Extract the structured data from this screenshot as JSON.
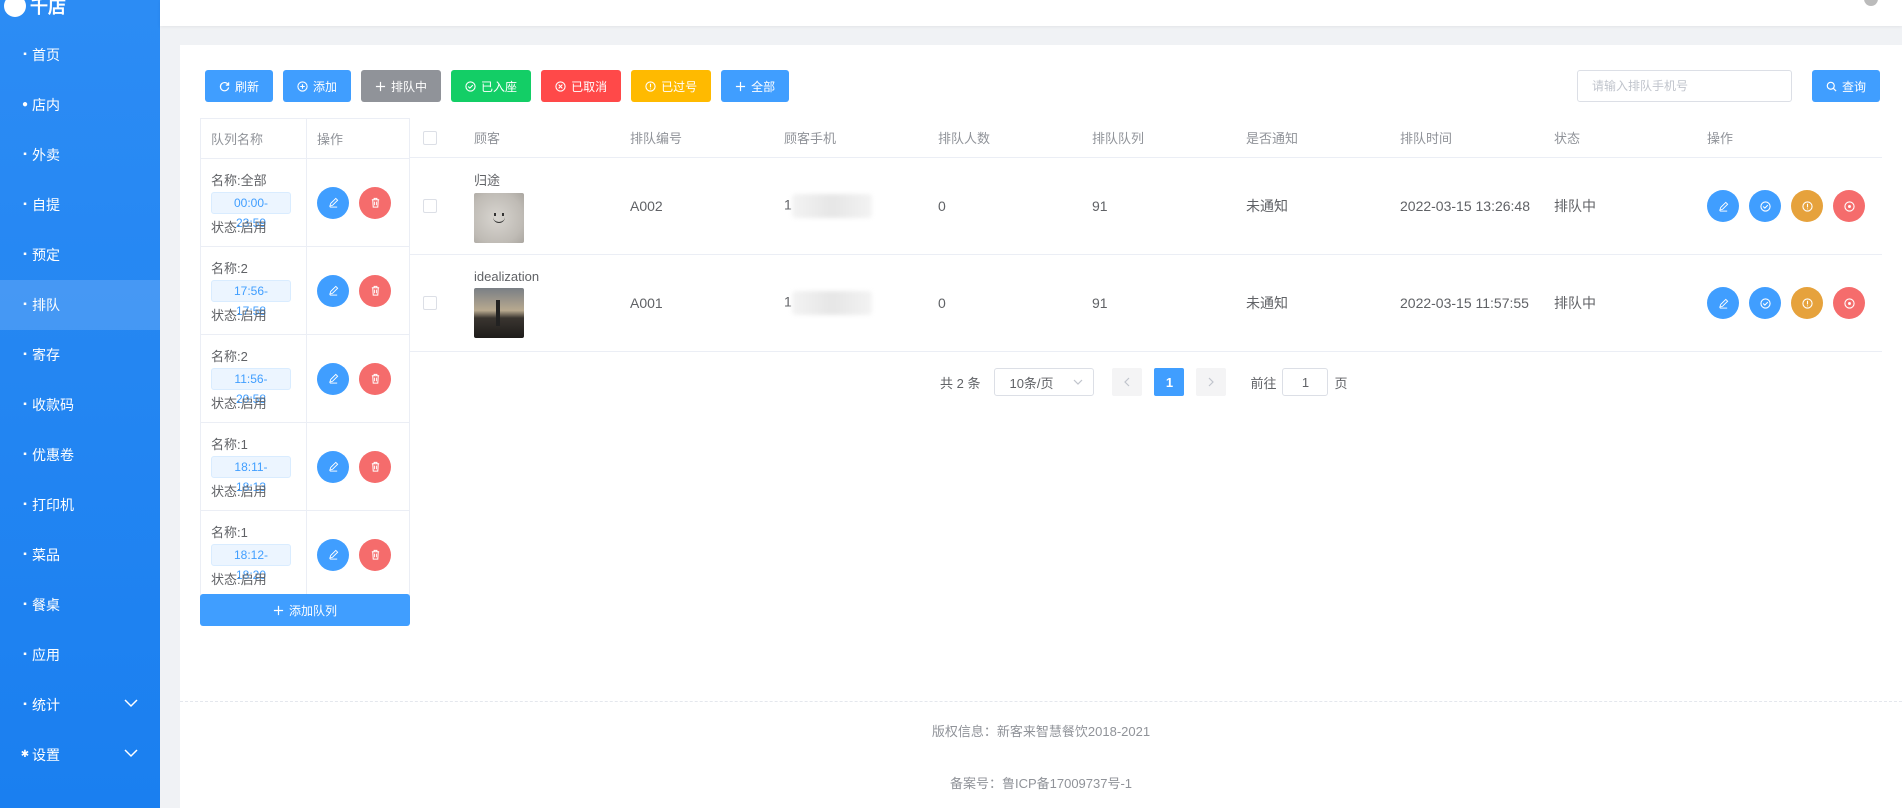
{
  "app": {
    "logo_text": "千店"
  },
  "sidebar": {
    "items": [
      {
        "label": "首页",
        "icon": "home-icon"
      },
      {
        "label": "店内",
        "icon": "user-icon"
      },
      {
        "label": "外卖",
        "icon": "delivery-icon"
      },
      {
        "label": "自提",
        "icon": "bag-icon"
      },
      {
        "label": "预定",
        "icon": "cart-icon"
      },
      {
        "label": "排队",
        "icon": "queue-icon",
        "active": true
      },
      {
        "label": "寄存",
        "icon": "box-icon"
      },
      {
        "label": "收款码",
        "icon": "qrcode-icon"
      },
      {
        "label": "优惠卷",
        "icon": "coupon-icon"
      },
      {
        "label": "打印机",
        "icon": "printer-icon"
      },
      {
        "label": "菜品",
        "icon": "dish-icon"
      },
      {
        "label": "餐桌",
        "icon": "table-icon"
      },
      {
        "label": "应用",
        "icon": "app-icon"
      },
      {
        "label": "统计",
        "icon": "stats-icon",
        "expandable": true
      },
      {
        "label": "设置",
        "icon": "gear-icon",
        "expandable": true
      }
    ]
  },
  "toolbar": {
    "refresh": "刷新",
    "add": "添加",
    "queuing": "排队中",
    "seated": "已入座",
    "cancelled": "已取消",
    "passed": "已过号",
    "all": "全部"
  },
  "search": {
    "placeholder": "请输入排队手机号",
    "button": "查询"
  },
  "queue_table": {
    "headers": {
      "name": "队列名称",
      "ops": "操作"
    },
    "rows": [
      {
        "name": "名称:全部",
        "time": "00:00-23:59",
        "status": "状态:启用"
      },
      {
        "name": "名称:2",
        "time": "17:56-17:58",
        "status": "状态:启用"
      },
      {
        "name": "名称:2",
        "time": "11:56-20:58",
        "status": "状态:启用"
      },
      {
        "name": "名称:1",
        "time": "18:11-18:13",
        "status": "状态:启用"
      },
      {
        "name": "名称:1",
        "time": "18:12-18:20",
        "status": "状态:启用"
      }
    ],
    "add_button": "添加队列"
  },
  "main_table": {
    "headers": {
      "customer": "顾客",
      "number": "排队编号",
      "phone": "顾客手机",
      "count": "排队人数",
      "queue": "排队队列",
      "notify": "是否通知",
      "time": "排队时间",
      "status": "状态",
      "ops": "操作"
    },
    "rows": [
      {
        "customer": "归途",
        "number": "A002",
        "phone": "1",
        "count": "0",
        "queue": "91",
        "notify": "未通知",
        "time": "2022-03-15 13:26:48",
        "status": "排队中"
      },
      {
        "customer": "idealization",
        "number": "A001",
        "phone": "1",
        "count": "0",
        "queue": "91",
        "notify": "未通知",
        "time": "2022-03-15 11:57:55",
        "status": "排队中"
      }
    ]
  },
  "pagination": {
    "total": "共 2 条",
    "page_size": "10条/页",
    "current": "1",
    "goto_label": "前往",
    "goto_value": "1",
    "page_suffix": "页"
  },
  "footer": {
    "copyright": "版权信息：新客来智慧餐饮2018-2021",
    "icp": "备案号：鲁ICP备17009737号-1"
  },
  "colors": {
    "sidebar": "#2c8cf4",
    "primary": "#409eff",
    "success": "#13ce66",
    "danger": "#ff4949",
    "warning": "#ffba00",
    "info": "#909399"
  }
}
